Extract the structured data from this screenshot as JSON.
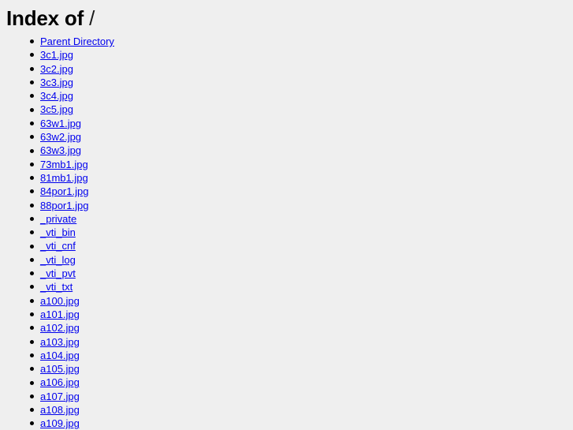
{
  "page": {
    "title_prefix": "Index of",
    "path": "/",
    "background_color": "#efefef",
    "link_color": "#0000ee",
    "text_color": "#000000"
  },
  "listing": {
    "bullet_icon": "disc-bullet-icon",
    "entries": [
      {
        "label": "Parent Directory",
        "type": "parent-directory"
      },
      {
        "label": "3c1.jpg",
        "type": "file"
      },
      {
        "label": "3c2.jpg",
        "type": "file"
      },
      {
        "label": "3c3.jpg",
        "type": "file"
      },
      {
        "label": "3c4.jpg",
        "type": "file"
      },
      {
        "label": "3c5.jpg",
        "type": "file"
      },
      {
        "label": "63w1.jpg",
        "type": "file"
      },
      {
        "label": "63w2.jpg",
        "type": "file"
      },
      {
        "label": "63w3.jpg",
        "type": "file"
      },
      {
        "label": "73mb1.jpg",
        "type": "file"
      },
      {
        "label": "81mb1.jpg",
        "type": "file"
      },
      {
        "label": "84por1.jpg",
        "type": "file"
      },
      {
        "label": "88por1.jpg",
        "type": "file"
      },
      {
        "label": "_private",
        "type": "directory"
      },
      {
        "label": "_vti_bin",
        "type": "directory"
      },
      {
        "label": "_vti_cnf",
        "type": "directory"
      },
      {
        "label": "_vti_log",
        "type": "directory"
      },
      {
        "label": "_vti_pvt",
        "type": "directory"
      },
      {
        "label": "_vti_txt",
        "type": "directory"
      },
      {
        "label": "a100.jpg",
        "type": "file"
      },
      {
        "label": "a101.jpg",
        "type": "file"
      },
      {
        "label": "a102.jpg",
        "type": "file"
      },
      {
        "label": "a103.jpg",
        "type": "file"
      },
      {
        "label": "a104.jpg",
        "type": "file"
      },
      {
        "label": "a105.jpg",
        "type": "file"
      },
      {
        "label": "a106.jpg",
        "type": "file"
      },
      {
        "label": "a107.jpg",
        "type": "file"
      },
      {
        "label": "a108.jpg",
        "type": "file"
      },
      {
        "label": "a109.jpg",
        "type": "file"
      }
    ]
  }
}
